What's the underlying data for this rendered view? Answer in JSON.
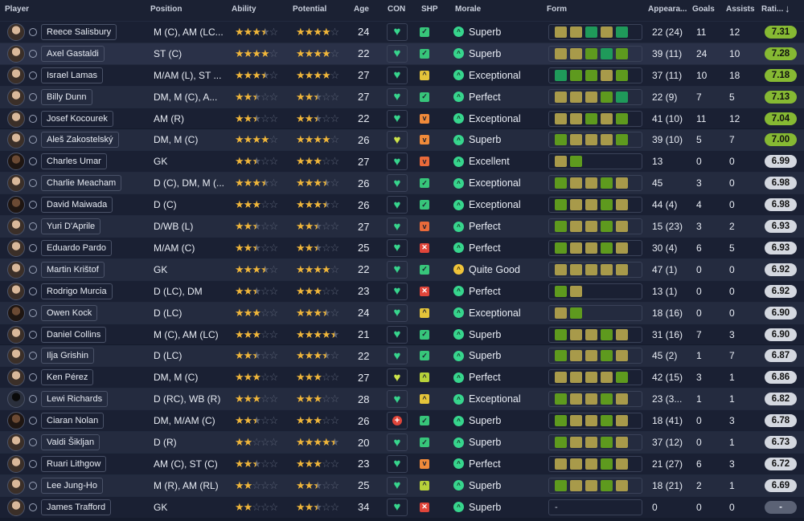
{
  "header": {
    "player": "Player",
    "position": "Position",
    "ability": "Ability",
    "potential": "Potential",
    "age": "Age",
    "con": "CON",
    "shp": "SHP",
    "morale": "Morale",
    "form": "Form",
    "appearances": "Appeara...",
    "goals": "Goals",
    "assists": "Assists",
    "rating": "Rati...",
    "sort_icon": "arrow-down-icon"
  },
  "colors": {
    "rating_high": "#86b933",
    "rating_mid": "#c6d25a",
    "rating_low": "#d4d8e0",
    "con_green": "#37d58d",
    "morale_green": "#37d58d",
    "star": "#f0b63a",
    "form_average": "#a89a4a",
    "form_good": "#5e9a1e",
    "form_excellent": "#1f9a5a"
  },
  "players": [
    {
      "name": "Reece Salisbury",
      "position": "M (C), AM (LC...",
      "ability": 3.5,
      "potential": 4,
      "age": "24",
      "con": "heart",
      "shp": "check",
      "morale": "Superb",
      "morale_icon": "g",
      "form": "AACAC",
      "apps": "22 (24)",
      "goals": "11",
      "assists": "12",
      "rating": "7.31",
      "rclass": "hi",
      "avatar": "l"
    },
    {
      "name": "Axel Gastaldi",
      "position": "ST (C)",
      "ability": 4,
      "potential": 4,
      "age": "22",
      "con": "heart",
      "shp": "check",
      "morale": "Superb",
      "morale_icon": "g",
      "form": "AABCB",
      "apps": "39 (11)",
      "goals": "24",
      "assists": "10",
      "rating": "7.28",
      "rclass": "hi",
      "avatar": "l"
    },
    {
      "name": "Israel Lamas",
      "position": "M/AM (L), ST ...",
      "ability": 3.5,
      "potential": 4,
      "age": "27",
      "con": "heart",
      "shp": "up",
      "morale": "Exceptional",
      "morale_icon": "g",
      "form": "CBBAB",
      "apps": "37 (11)",
      "goals": "10",
      "assists": "18",
      "rating": "7.18",
      "rclass": "hi",
      "avatar": "l"
    },
    {
      "name": "Billy Dunn",
      "position": "DM, M (C), A...",
      "ability": 2.5,
      "potential": 2.5,
      "age": "27",
      "con": "heart",
      "shp": "check",
      "morale": "Perfect",
      "morale_icon": "g",
      "form": "AAABC",
      "apps": "22 (9)",
      "goals": "7",
      "assists": "5",
      "rating": "7.13",
      "rclass": "hi",
      "avatar": "l"
    },
    {
      "name": "Josef Kocourek",
      "position": "AM (R)",
      "ability": 2.5,
      "potential": 2.5,
      "age": "22",
      "con": "heart",
      "shp": "down",
      "morale": "Exceptional",
      "morale_icon": "g",
      "form": "AABAB",
      "apps": "41 (10)",
      "goals": "11",
      "assists": "12",
      "rating": "7.04",
      "rclass": "hi",
      "avatar": "l"
    },
    {
      "name": "Aleš Zakostelský",
      "position": "DM, M (C)",
      "ability": 4,
      "potential": 4,
      "age": "26",
      "con": "heart-y",
      "shp": "down",
      "morale": "Superb",
      "morale_icon": "g",
      "form": "BAAAB",
      "apps": "39 (10)",
      "goals": "5",
      "assists": "7",
      "rating": "7.00",
      "rclass": "hi",
      "avatar": "l"
    },
    {
      "name": "Charles Umar",
      "position": "GK",
      "ability": 2.5,
      "potential": 3,
      "age": "27",
      "con": "heart",
      "shp": "downdown",
      "morale": "Excellent",
      "morale_icon": "g",
      "form": "AB",
      "apps": "13",
      "goals": "0",
      "assists": "0",
      "rating": "6.99",
      "rclass": "lo",
      "avatar": "d"
    },
    {
      "name": "Charlie Meacham",
      "position": "D (C), DM, M (...",
      "ability": 3.5,
      "potential": 3.5,
      "age": "26",
      "con": "heart",
      "shp": "check",
      "morale": "Exceptional",
      "morale_icon": "g",
      "form": "BAABA",
      "apps": "45",
      "goals": "3",
      "assists": "0",
      "rating": "6.98",
      "rclass": "lo",
      "avatar": "l"
    },
    {
      "name": "David Maiwada",
      "position": "D (C)",
      "ability": 3,
      "potential": 3.5,
      "age": "26",
      "con": "heart",
      "shp": "check",
      "morale": "Exceptional",
      "morale_icon": "g",
      "form": "BAABA",
      "apps": "44 (4)",
      "goals": "4",
      "assists": "0",
      "rating": "6.98",
      "rclass": "lo",
      "avatar": "d"
    },
    {
      "name": "Yuri D'Aprile",
      "position": "D/WB (L)",
      "ability": 2.5,
      "potential": 2.5,
      "age": "27",
      "con": "heart",
      "shp": "downdown",
      "morale": "Perfect",
      "morale_icon": "g",
      "form": "BAABA",
      "apps": "15 (23)",
      "goals": "3",
      "assists": "2",
      "rating": "6.93",
      "rclass": "lo",
      "avatar": "l"
    },
    {
      "name": "Eduardo Pardo",
      "position": "M/AM (C)",
      "ability": 2.5,
      "potential": 2.5,
      "age": "25",
      "con": "heart",
      "shp": "x",
      "morale": "Perfect",
      "morale_icon": "g",
      "form": "BAABA",
      "apps": "30 (4)",
      "goals": "6",
      "assists": "5",
      "rating": "6.93",
      "rclass": "lo",
      "avatar": "l"
    },
    {
      "name": "Martin Krištof",
      "position": "GK",
      "ability": 3.5,
      "potential": 4,
      "age": "22",
      "con": "heart",
      "shp": "check",
      "morale": "Quite Good",
      "morale_icon": "y",
      "form": "AAAAA",
      "apps": "47 (1)",
      "goals": "0",
      "assists": "0",
      "rating": "6.92",
      "rclass": "lo",
      "avatar": "l"
    },
    {
      "name": "Rodrigo Murcia",
      "position": "D (LC), DM",
      "ability": 2.5,
      "potential": 3,
      "age": "23",
      "con": "heart",
      "shp": "x",
      "morale": "Perfect",
      "morale_icon": "g",
      "form": "BA",
      "apps": "13 (1)",
      "goals": "0",
      "assists": "0",
      "rating": "6.92",
      "rclass": "lo",
      "avatar": "l"
    },
    {
      "name": "Owen Kock",
      "position": "D (LC)",
      "ability": 3,
      "potential": 3.5,
      "age": "24",
      "con": "heart",
      "shp": "up",
      "morale": "Exceptional",
      "morale_icon": "g",
      "form": "AB",
      "apps": "18 (16)",
      "goals": "0",
      "assists": "0",
      "rating": "6.90",
      "rclass": "lo",
      "avatar": "d"
    },
    {
      "name": "Daniel Collins",
      "position": "M (C), AM (LC)",
      "ability": 3,
      "potential": 4.5,
      "age": "21",
      "con": "heart",
      "shp": "check",
      "morale": "Superb",
      "morale_icon": "g",
      "form": "BAABA",
      "apps": "31 (16)",
      "goals": "7",
      "assists": "3",
      "rating": "6.90",
      "rclass": "lo",
      "avatar": "l"
    },
    {
      "name": "Ilja Grishin",
      "position": "D (LC)",
      "ability": 2.5,
      "potential": 3.5,
      "age": "22",
      "con": "heart",
      "shp": "check",
      "morale": "Superb",
      "morale_icon": "g",
      "form": "BAABA",
      "apps": "45 (2)",
      "goals": "1",
      "assists": "7",
      "rating": "6.87",
      "rclass": "lo",
      "avatar": "l"
    },
    {
      "name": "Ken Pérez",
      "position": "DM, M (C)",
      "ability": 3,
      "potential": 3,
      "age": "27",
      "con": "heart-y",
      "shp": "upup",
      "morale": "Perfect",
      "morale_icon": "g",
      "form": "AAAAB",
      "apps": "42 (15)",
      "goals": "3",
      "assists": "1",
      "rating": "6.86",
      "rclass": "lo",
      "avatar": "l"
    },
    {
      "name": "Lewi Richards",
      "position": "D (RC), WB (R)",
      "ability": 3,
      "potential": 3,
      "age": "28",
      "con": "heart",
      "shp": "up",
      "morale": "Exceptional",
      "morale_icon": "g",
      "form": "BAABA",
      "apps": "23 (3...",
      "goals": "1",
      "assists": "1",
      "rating": "6.82",
      "rclass": "lo",
      "avatar": "s"
    },
    {
      "name": "Ciaran Nolan",
      "position": "DM, M/AM (C)",
      "ability": 2.5,
      "potential": 3,
      "age": "26",
      "con": "red",
      "shp": "check",
      "morale": "Superb",
      "morale_icon": "g",
      "form": "BAABA",
      "apps": "18 (41)",
      "goals": "0",
      "assists": "3",
      "rating": "6.78",
      "rclass": "lo",
      "avatar": "d"
    },
    {
      "name": "Valdi Šikljan",
      "position": "D (R)",
      "ability": 2,
      "potential": 4.5,
      "age": "20",
      "con": "heart",
      "shp": "check",
      "morale": "Superb",
      "morale_icon": "g",
      "form": "BAABA",
      "apps": "37 (12)",
      "goals": "0",
      "assists": "1",
      "rating": "6.73",
      "rclass": "lo",
      "avatar": "l"
    },
    {
      "name": "Ruari Lithgow",
      "position": "AM (C), ST (C)",
      "ability": 2.5,
      "potential": 3,
      "age": "23",
      "con": "heart",
      "shp": "down",
      "morale": "Perfect",
      "morale_icon": "g",
      "form": "AAABA",
      "apps": "21 (27)",
      "goals": "6",
      "assists": "3",
      "rating": "6.72",
      "rclass": "lo",
      "avatar": "l"
    },
    {
      "name": "Lee Jung-Ho",
      "position": "M (R), AM (RL)",
      "ability": 2,
      "potential": 2.5,
      "age": "25",
      "con": "heart",
      "shp": "upup",
      "morale": "Superb",
      "morale_icon": "g",
      "form": "BAABA",
      "apps": "18 (21)",
      "goals": "2",
      "assists": "1",
      "rating": "6.69",
      "rclass": "lo",
      "avatar": "l"
    },
    {
      "name": "James Trafford",
      "position": "GK",
      "ability": 2,
      "potential": 2.5,
      "age": "34",
      "con": "heart",
      "shp": "x",
      "morale": "Superb",
      "morale_icon": "g",
      "form": "-",
      "apps": "0",
      "goals": "0",
      "assists": "0",
      "rating": "-",
      "rclass": "na",
      "avatar": "l"
    }
  ]
}
